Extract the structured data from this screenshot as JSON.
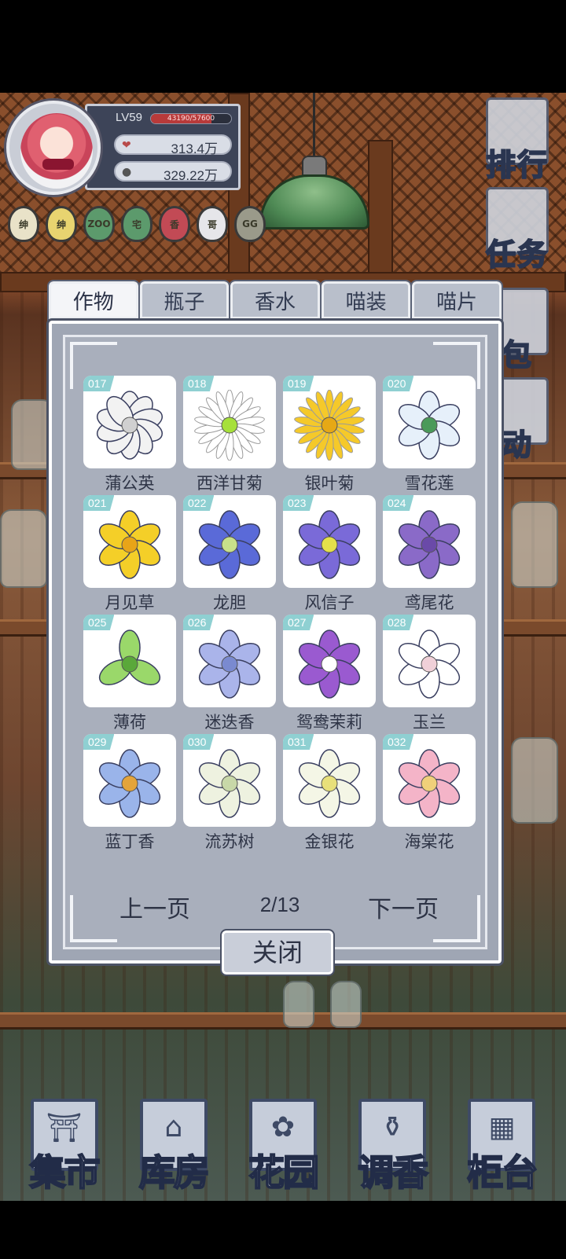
{
  "profile": {
    "level": "LV59",
    "xp_text": "43190/57600",
    "xp_fraction": 0.75,
    "stat1": "313.4万",
    "stat2": "329.22万"
  },
  "badges": [
    {
      "text": "绅",
      "color": "#e9e2c8"
    },
    {
      "text": "绅",
      "color": "#e8d470"
    },
    {
      "text": "ZOO",
      "color": "#5c9a6c"
    },
    {
      "text": "宅",
      "color": "#5c9a6c"
    },
    {
      "text": "香",
      "color": "#c24a55"
    },
    {
      "text": "哥",
      "color": "#e6e6ea"
    },
    {
      "text": "GG",
      "color": "#9a9a8a"
    }
  ],
  "side_menu": {
    "rank": "排行",
    "task": "任务",
    "bag": "包",
    "event": "动"
  },
  "tabs": [
    "作物",
    "瓶子",
    "香水",
    "喵装",
    "喵片"
  ],
  "active_tab": 0,
  "items": [
    {
      "num": "017",
      "name": "蒲公英",
      "icon": "white-cluster-flower",
      "color": "#f2f2f2",
      "center": "#d0d0d0"
    },
    {
      "num": "018",
      "name": "西洋甘菊",
      "icon": "daisy-flower",
      "color": "#ffffff",
      "center": "#a6e03a"
    },
    {
      "num": "019",
      "name": "银叶菊",
      "icon": "yellow-chrysanthemum",
      "color": "#f5c92a",
      "center": "#e6a816"
    },
    {
      "num": "020",
      "name": "雪花莲",
      "icon": "snowdrop-flower",
      "color": "#e6f0fa",
      "center": "#4a9a5a"
    },
    {
      "num": "021",
      "name": "月见草",
      "icon": "evening-primrose",
      "color": "#f4cf28",
      "center": "#e8a418"
    },
    {
      "num": "022",
      "name": "龙胆",
      "icon": "gentian-flower",
      "color": "#5a6ad8",
      "center": "#c8e08a"
    },
    {
      "num": "023",
      "name": "风信子",
      "icon": "hyacinth-star-flower",
      "color": "#7a6ad8",
      "center": "#e4e04a"
    },
    {
      "num": "024",
      "name": "鸢尾花",
      "icon": "iris-flower",
      "color": "#8a6ac8",
      "center": "#6a4aa8"
    },
    {
      "num": "025",
      "name": "薄荷",
      "icon": "mint-leaves",
      "color": "#9ad86a",
      "center": "#5aa83a"
    },
    {
      "num": "026",
      "name": "迷迭香",
      "icon": "rosemary-flower",
      "color": "#aab4ea",
      "center": "#7a8ad0"
    },
    {
      "num": "027",
      "name": "鸳鸯茉莉",
      "icon": "jasmine-flower",
      "color": "#9a5ad0",
      "center": "#ffffff"
    },
    {
      "num": "028",
      "name": "玉兰",
      "icon": "magnolia-flower",
      "color": "#ffffff",
      "center": "#f0d0d8"
    },
    {
      "num": "029",
      "name": "蓝丁香",
      "icon": "blue-lilac-flower",
      "color": "#9ab4ea",
      "center": "#e4a43a"
    },
    {
      "num": "030",
      "name": "流苏树",
      "icon": "fringe-tree-flower",
      "color": "#eef2e0",
      "center": "#c8d8a8"
    },
    {
      "num": "031",
      "name": "金银花",
      "icon": "honeysuckle-flower",
      "color": "#f4f6e6",
      "center": "#e8e07a"
    },
    {
      "num": "032",
      "name": "海棠花",
      "icon": "begonia-flower",
      "color": "#f4b4c8",
      "center": "#f0d07a"
    }
  ],
  "pager": {
    "prev": "上一页",
    "page": "2/13",
    "next": "下一页"
  },
  "close_label": "关闭",
  "bottom_nav": [
    {
      "label": "集市",
      "icon": "market-gate-icon"
    },
    {
      "label": "库房",
      "icon": "warehouse-icon"
    },
    {
      "label": "花园",
      "icon": "rose-icon"
    },
    {
      "label": "调香",
      "icon": "perfume-bottle-icon"
    },
    {
      "label": "柜台",
      "icon": "counter-shelf-icon"
    }
  ]
}
